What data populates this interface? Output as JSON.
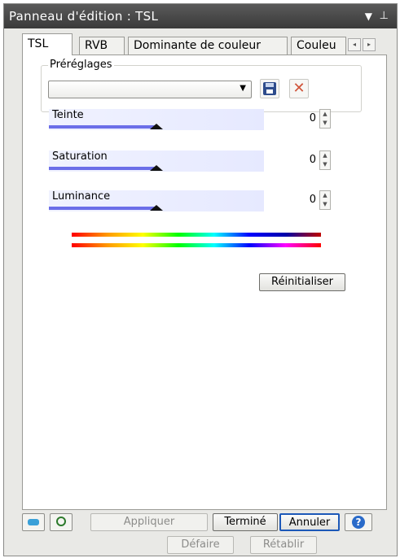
{
  "window": {
    "title": "Panneau d'édition : TSL",
    "menu_icon": "dropdown-triangle-icon",
    "pin_icon": "pin-icon"
  },
  "tabs": [
    {
      "label": "TSL",
      "active": true
    },
    {
      "label": "RVB",
      "active": false
    },
    {
      "label": "Dominante de couleur",
      "active": false
    },
    {
      "label": "Couleu",
      "active": false
    }
  ],
  "tab_scroll": {
    "left": "◂",
    "right": "▸"
  },
  "presets": {
    "label": "Préréglages",
    "selected": "",
    "save_icon": "floppy-disk-icon",
    "delete_icon": "red-x-icon",
    "delete_glyph": "✕"
  },
  "sliders": [
    {
      "label": "Teinte",
      "value": "0",
      "level": 0.5
    },
    {
      "label": "Saturation",
      "value": "0",
      "level": 0.5
    },
    {
      "label": "Luminance",
      "value": "0",
      "level": 0.5
    }
  ],
  "reset_label": "Réinitialiser",
  "bottom": {
    "apply": "Appliquer",
    "done": "Terminé",
    "cancel": "Annuler",
    "help_glyph": "?"
  },
  "undo": {
    "undo": "Défaire",
    "redo": "Rétablir"
  }
}
